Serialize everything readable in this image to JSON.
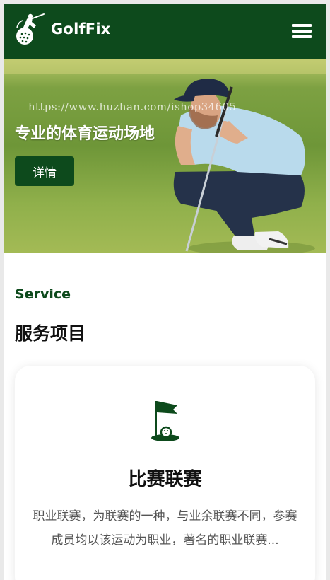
{
  "header": {
    "brand": "GolfFix",
    "logo_icon": "golfer-logo-icon",
    "menu_icon": "hamburger-menu-icon",
    "bg_color": "#0d4a1c"
  },
  "hero": {
    "watermark": "https://www.huzhan.com/ishop34605",
    "title": "专业的体育运动场地",
    "button_label": "详情"
  },
  "service": {
    "label_en": "Service",
    "label_zh": "服务项目",
    "card": {
      "icon": "golf-flag-icon",
      "title": "比赛联赛",
      "description": "职业联赛，为联赛的一种，与业余联赛不同，参赛成员均以该运动为职业，著名的职业联赛..."
    }
  },
  "colors": {
    "brand_green": "#0d4a1c",
    "text_dark": "#111111",
    "text_muted": "#555555"
  }
}
